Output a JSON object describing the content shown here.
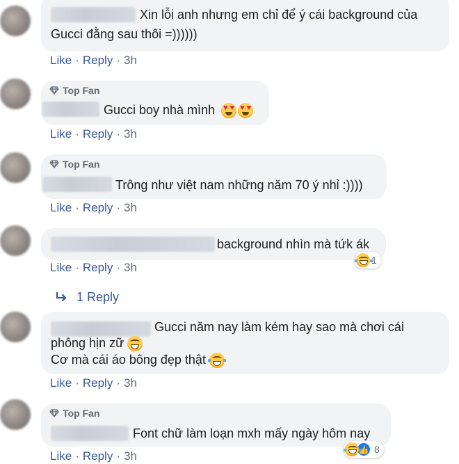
{
  "comments": [
    {
      "text_lines": [
        "Xin lỗi anh nhưng em chỉ để ý cái background của",
        "Gucci đằng sau thôi =))))))"
      ],
      "like": "Like",
      "reply": "Reply",
      "time": "3h"
    },
    {
      "badge": "Top Fan",
      "text_lines": [
        "Gucci boy nhà mình"
      ],
      "emojis": [
        "heart-eyes-emoji",
        "heart-eyes-emoji"
      ],
      "like": "Like",
      "reply": "Reply",
      "time": "3h"
    },
    {
      "badge": "Top Fan",
      "text_lines": [
        "Trông như việt nam những năm 70 ý nhỉ :))))"
      ],
      "like": "Like",
      "reply": "Reply",
      "time": "3h"
    },
    {
      "text_lines": [
        "background nhìn mà tứk ák"
      ],
      "reaction_count": "1",
      "like": "Like",
      "reply": "Reply",
      "time": "3h",
      "replies_label": "1 Reply"
    },
    {
      "text_lines": [
        "Gucci năm nay làm kém hay sao mà chơi cái",
        "phông hịn zữ",
        "Cơ mà cái áo bông đẹp thật"
      ],
      "like": "Like",
      "reply": "Reply",
      "time": "3h"
    },
    {
      "badge": "Top Fan",
      "text_lines": [
        "Font chữ làm loạn mxh mấy ngày hôm nay"
      ],
      "reaction_count": "8",
      "like": "Like",
      "reply": "Reply",
      "time": "3h"
    }
  ],
  "colors": {
    "bubble": "#f2f3f5",
    "link": "#385898",
    "meta": "#606770"
  }
}
